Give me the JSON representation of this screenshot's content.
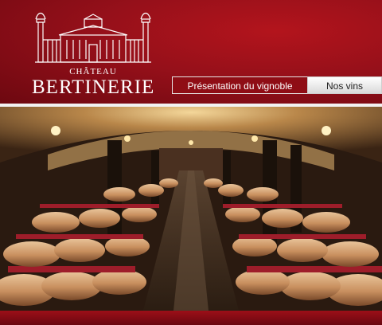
{
  "brand": {
    "prefix": "CHÂTEAU",
    "name": "BERTINERIE"
  },
  "nav": {
    "tabs": [
      {
        "label": "Présentation du vignoble",
        "active": true
      },
      {
        "label": "Nos vins",
        "active": false
      }
    ]
  },
  "colors": {
    "brand_red": "#96101a",
    "tab_active_bg": "#8f0d15",
    "tab_inactive_bg": "#e6e6e6"
  }
}
